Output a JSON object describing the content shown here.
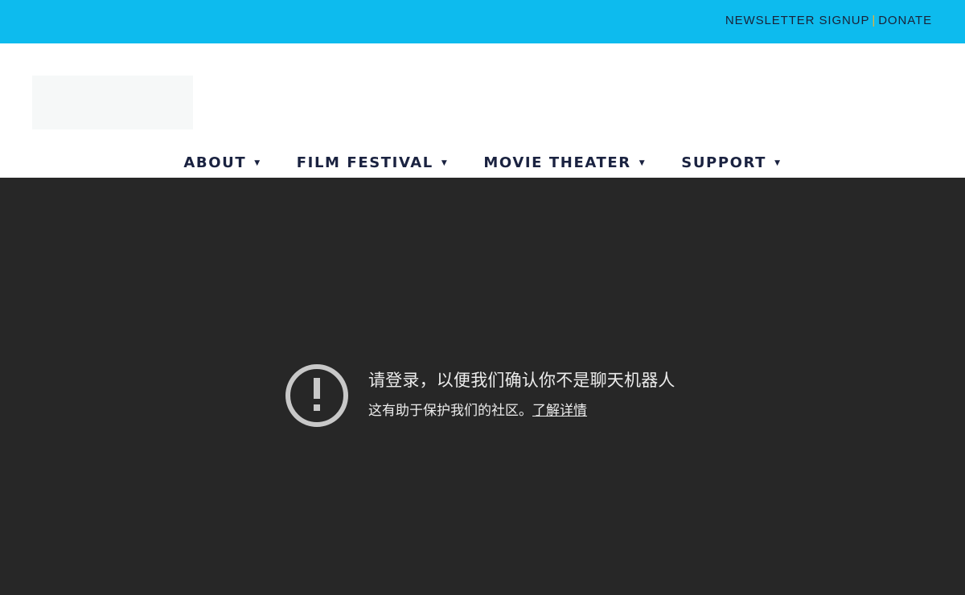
{
  "topbar": {
    "links": [
      {
        "label": "NEWSLETTER SIGNUP"
      },
      {
        "label": "DONATE"
      }
    ],
    "separator": "|",
    "colors": {
      "background": "#0dbbee",
      "separator": "#f2b233"
    }
  },
  "nav": {
    "items": [
      {
        "label": "ABOUT",
        "icon": "caret-down-icon"
      },
      {
        "label": "FILM FESTIVAL",
        "icon": "caret-down-icon"
      },
      {
        "label": "MOVIE THEATER",
        "icon": "caret-down-icon"
      },
      {
        "label": "SUPPORT",
        "icon": "caret-down-icon"
      }
    ],
    "caret": "▼"
  },
  "notice": {
    "icon": "alert-circle-icon",
    "title": "请登录，以便我们确认你不是聊天机器人",
    "subtitle": "这有助于保护我们的社区。",
    "learn_more": "了解详情"
  }
}
